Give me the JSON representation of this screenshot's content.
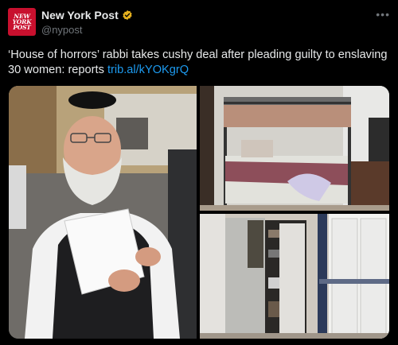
{
  "account": {
    "avatar_text": [
      "NEW",
      "YORK",
      "POST"
    ],
    "display_name": "New York Post",
    "handle": "@nypost",
    "verified": true
  },
  "menu_icon": "more-horizontal-icon",
  "tweet": {
    "text": "‘House of horrors’ rabbi takes cushy deal after pleading guilty to enslaving 30 women: reports",
    "link": "trib.al/kYOKgrQ"
  },
  "media": [
    {
      "name": "rabbi-photo"
    },
    {
      "name": "bunk-bed-photo"
    },
    {
      "name": "closet-photo"
    }
  ],
  "colors": {
    "background": "#000000",
    "brand_red": "#c8102e",
    "link": "#1d9bf0",
    "verified_gold": "#e8b21e",
    "secondary_text": "#71767b"
  }
}
